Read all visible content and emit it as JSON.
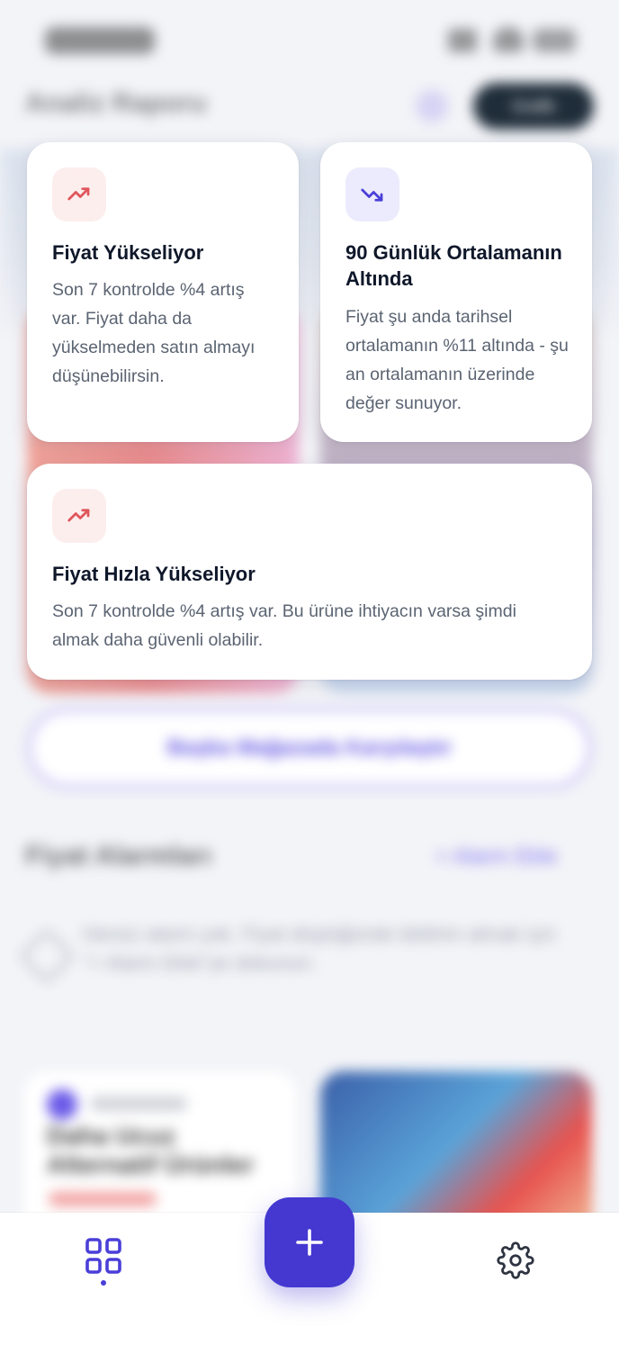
{
  "header": {
    "title": "Analiz Raporu",
    "action_label": "Grafik"
  },
  "cards": [
    {
      "title": "Fiyat Yükseliyor",
      "body": "Son 7 kontrolde %4 artış var. Fiyat daha da yükselmeden satın almayı düşünebilirsin.",
      "icon": "trending-up-icon",
      "accent": "#e0565b"
    },
    {
      "title": "90 Günlük Ortalamanın Altında",
      "body": "Fiyat şu anda tarihsel ortalamanın %11 altında - şu an ortalamanın üzerinde değer sunuyor.",
      "icon": "trending-down-icon",
      "accent": "#4a3fd8"
    },
    {
      "title": "Fiyat Hızla Yükseliyor",
      "body": "Son 7 kontrolde %4 artış var. Bu ürüne ihtiyacın varsa şimdi almak daha güvenli olabilir.",
      "icon": "trending-up-icon",
      "accent": "#e0565b"
    }
  ],
  "compare_button": {
    "label": "Başka Mağazada Karşılaştır"
  },
  "alarms": {
    "title": "Fiyat Alarmları",
    "add_label": "+ Alarm Ekle",
    "empty_text": "Henüz alarm yok. Fiyat düştüğünde bildirim almak için \"+ Alarm Ekle\"ye dokunun."
  },
  "promo": {
    "title": "Daha Ucuz Alternatif Ürünler"
  },
  "nav": {
    "items": [
      "grid-icon",
      "plus-icon",
      "settings-icon"
    ],
    "accent": "#4438d1"
  }
}
